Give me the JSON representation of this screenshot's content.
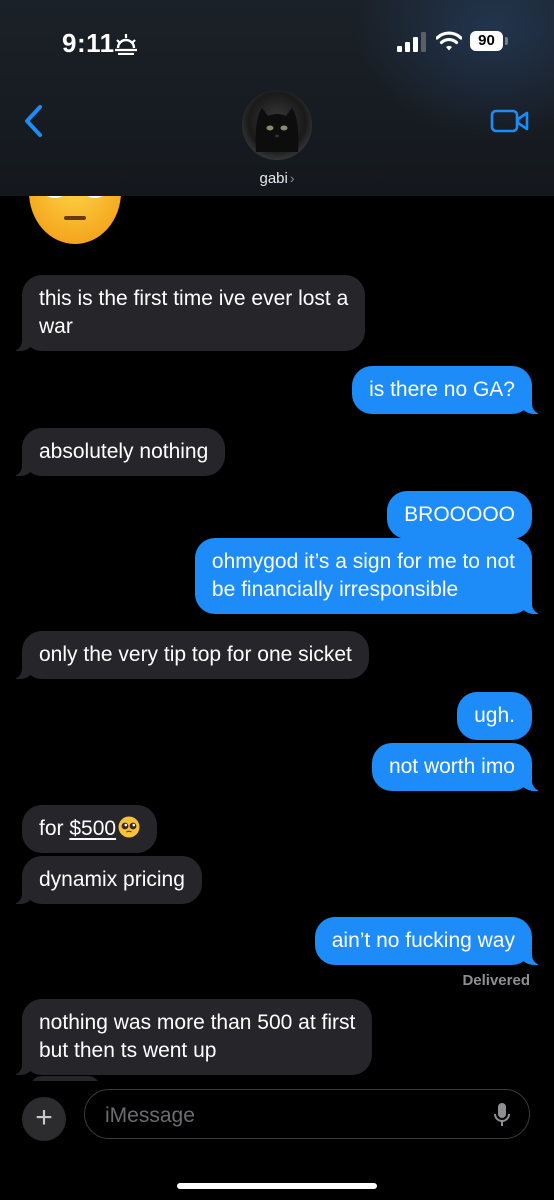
{
  "status_bar": {
    "time": "9:11",
    "battery": "90",
    "icons": [
      "sunset-icon",
      "signal-icon",
      "wifi-icon",
      "battery-icon"
    ]
  },
  "header": {
    "contact_name": "gabi",
    "icons": [
      "back-chevron-icon",
      "avatar",
      "video-camera-icon"
    ]
  },
  "messages": [
    {
      "dir": "in",
      "lines": [
        "this is the first time ive ever lost a",
        "war"
      ]
    },
    {
      "dir": "out",
      "lines": [
        "is there no GA?"
      ]
    },
    {
      "dir": "in",
      "lines": [
        "absolutely nothing"
      ]
    },
    {
      "dir": "out",
      "lines": [
        "BROOOOO"
      ]
    },
    {
      "dir": "out",
      "lines": [
        "ohmygod it’s a sign for me to not",
        "be financially irresponsible"
      ]
    },
    {
      "dir": "in",
      "lines": [
        "only the very tip top for one sicket"
      ]
    },
    {
      "dir": "out",
      "lines": [
        "ugh."
      ]
    },
    {
      "dir": "out",
      "lines": [
        "not worth imo"
      ]
    },
    {
      "dir": "in",
      "prefix": "for ",
      "amount": "$500",
      "emoji": "pleading-face-emoji"
    },
    {
      "dir": "in",
      "lines": [
        "dynamix pricing"
      ]
    },
    {
      "dir": "out",
      "lines": [
        "ain’t no fucking way"
      ]
    },
    {
      "dir": "in",
      "lines": [
        "nothing was more than 500 at first",
        "but then ts went up"
      ]
    }
  ],
  "delivered_label": "Delivered",
  "input": {
    "placeholder": "iMessage",
    "plus_label": "+",
    "icons": [
      "plus-icon",
      "microphone-icon"
    ]
  },
  "colors": {
    "outgoing_bubble": "#1d8cf8",
    "incoming_bubble": "#26252a",
    "background": "#000000",
    "accent": "#1d8cf8"
  }
}
